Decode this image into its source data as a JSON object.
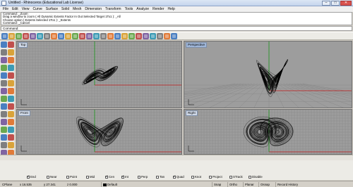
{
  "window": {
    "title": "Untitled - Rhinoceros (Educational Lab License)",
    "minimize": "–",
    "maximize": "□",
    "close": "✕"
  },
  "menu": [
    "File",
    "Edit",
    "View",
    "Curve",
    "Surface",
    "Solid",
    "Mesh",
    "Dimension",
    "Transform",
    "Tools",
    "Analyze",
    "Render",
    "Help"
  ],
  "history": [
    "Command: _Zoom",
    "Drag a window to zoom ( All  Dynamic  Extents  Factor  In  Out  Selected  Target  1To1 ): _All",
    "Choose option ( Extents  Selected  1To1 ): _Extents",
    "Command: _Cancel"
  ],
  "command": {
    "prompt": "Command:"
  },
  "viewports": {
    "top": "Top",
    "perspective": "Perspective",
    "front": "Front",
    "right": "Right"
  },
  "osnaps": [
    {
      "label": "End",
      "checked": true
    },
    {
      "label": "Near",
      "checked": false
    },
    {
      "label": "Point",
      "checked": false
    },
    {
      "label": "Mid",
      "checked": false
    },
    {
      "label": "Cen",
      "checked": true
    },
    {
      "label": "Int",
      "checked": true
    },
    {
      "label": "Perp",
      "checked": false
    },
    {
      "label": "Tan",
      "checked": false
    },
    {
      "label": "Quad",
      "checked": true
    },
    {
      "label": "Knot",
      "checked": false
    },
    {
      "label": "Project",
      "checked": false
    },
    {
      "label": "STrack",
      "checked": false
    },
    {
      "label": "Disable",
      "checked": false
    }
  ],
  "status": {
    "cplane": "CPlane",
    "x": "x 16.535",
    "y": "y 27.341",
    "z": "z 0.000",
    "layer": "Default",
    "snap": "Snap",
    "ortho": "Ortho",
    "planar": "Planar",
    "osnap": "Osnap",
    "record_history": "Record History"
  },
  "colors": {
    "viewport_bg": "#9d9d9d",
    "grid": "#8a8a8a",
    "axis_x": "#c01818",
    "axis_y": "#189418",
    "curve": "#000000"
  },
  "icons": {
    "toolbar": [
      "new-icon",
      "open-icon",
      "save-icon",
      "print-icon",
      "cut-icon",
      "copy-icon",
      "paste-icon",
      "undo-icon",
      "redo-icon",
      "pan-icon",
      "rotate-view-icon",
      "zoom-window-icon",
      "zoom-extents-icon",
      "zoom-selected-icon",
      "four-viewports-icon",
      "grid-icon",
      "layers-icon",
      "properties-icon",
      "render-icon",
      "shade-icon",
      "light-icon",
      "material-icon",
      "analyze-icon",
      "options-icon",
      "help-icon"
    ],
    "left": [
      "select-icon",
      "point-icon",
      "line-icon",
      "polyline-icon",
      "curve-icon",
      "circle-icon",
      "arc-icon",
      "ellipse-icon",
      "rectangle-icon",
      "polygon-icon",
      "fillet-icon",
      "offset-icon",
      "surface-icon",
      "loft-icon",
      "sweep-icon",
      "box-icon",
      "sphere-icon",
      "cylinder-icon",
      "mesh-icon",
      "boolean-icon",
      "move-icon",
      "copy-object-icon",
      "rotate-icon",
      "scale-icon",
      "mirror-icon",
      "array-icon",
      "trim-icon",
      "split-icon",
      "join-icon",
      "explode-icon"
    ]
  }
}
